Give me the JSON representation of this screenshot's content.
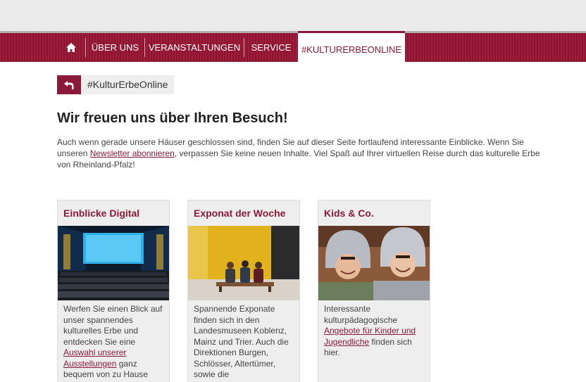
{
  "nav": {
    "home_icon": "home-icon",
    "items": [
      {
        "label": "ÜBER UNS"
      },
      {
        "label": "VERANSTALTUNGEN"
      },
      {
        "label": "SERVICE"
      },
      {
        "label": "#KULTURERBEONLINE",
        "active": true
      }
    ]
  },
  "breadcrumb": {
    "icon": "back-arrow-icon",
    "label": "#KulturErbeOnline"
  },
  "page": {
    "title": "Wir freuen uns über Ihren Besuch!",
    "intro_before": "Auch wenn gerade unsere Häuser geschlossen sind, finden Sie auf dieser Seite fortlaufend interessante Einblicke. Wenn Sie unseren ",
    "intro_link": "Newsletter abonnieren",
    "intro_after": ", verpassen Sie keine neuen Inhalte. Viel Spaß auf Ihrer virtuellen Reise durch das kulturelle Erbe von Rheinland-Pfalz!"
  },
  "cards": [
    {
      "title": "Einblicke Digital",
      "text_before": "Werfen Sie einen Blick auf unser spannendes kulturelles Erbe und entdecken Sie eine ",
      "link": "Auswahl unserer Ausstellungen",
      "text_after": " ganz bequem von zu Hause"
    },
    {
      "title": "Exponat der Woche",
      "text_before": "Spannende Exponate finden sich in den Landesmuseen Koblenz, Mainz und Trier. Auch die Direktionen Burgen, Schlösser, Altertümer, sowie die",
      "link": "",
      "text_after": ""
    },
    {
      "title": "Kids & Co.",
      "text_before": "Interessante kulturpädagogische ",
      "link": "Angebote für Kinder und Jugendliche",
      "text_after": " finden sich hier."
    }
  ],
  "colors": {
    "brand": "#8b1a3a",
    "nav_bg": "#9e1e3c",
    "card_bg": "#eeeeee"
  }
}
